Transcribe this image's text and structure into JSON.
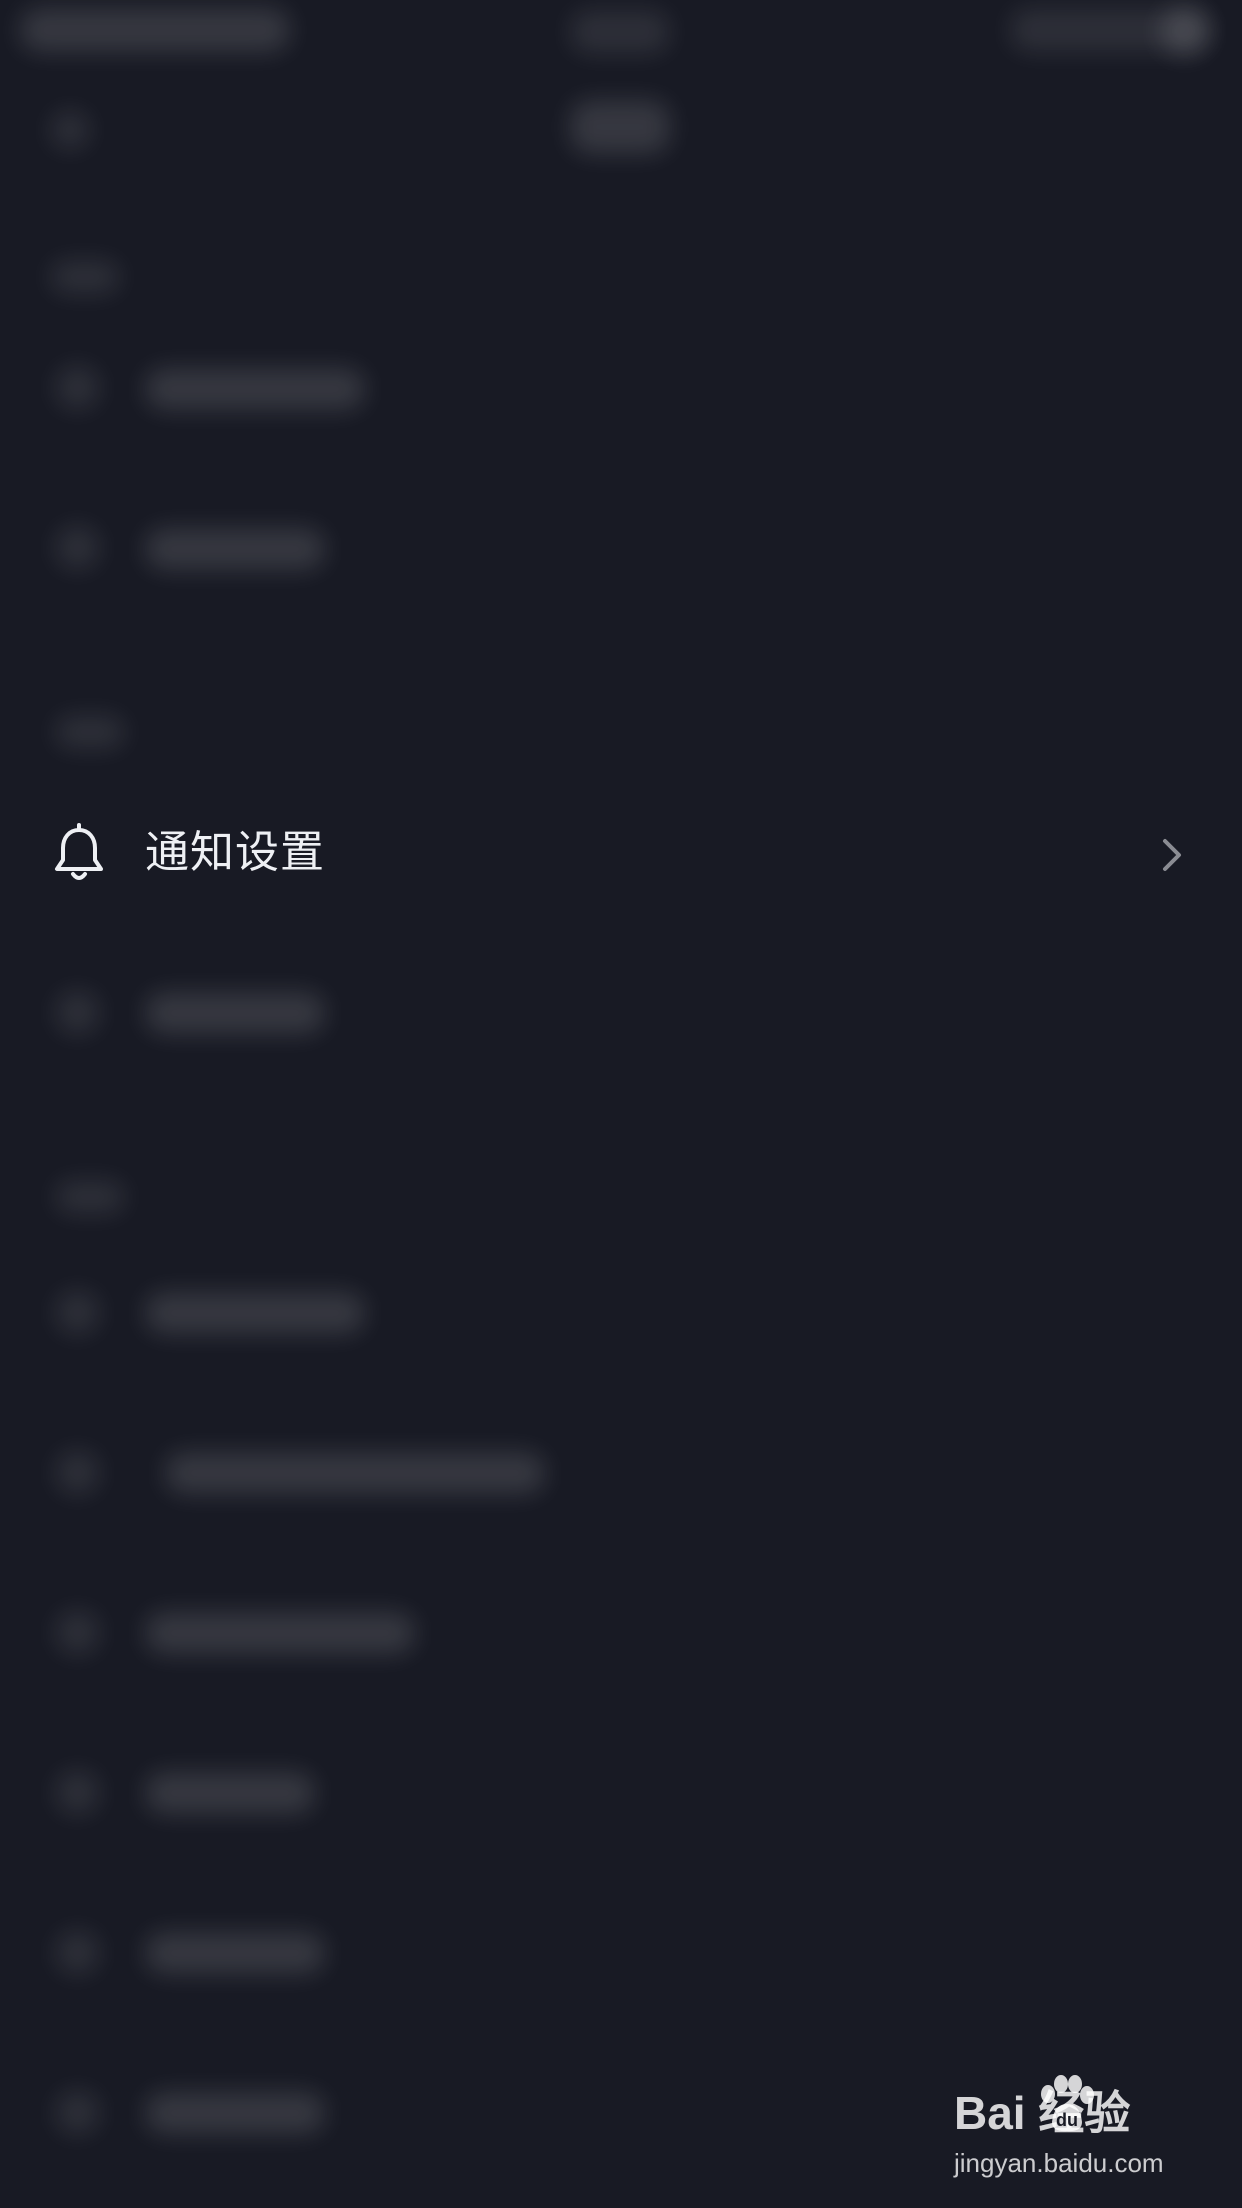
{
  "notification_row": {
    "label": "通知设置"
  },
  "icons": {
    "notification": "bell-icon",
    "row_arrow": "chevron-right-icon",
    "watermark_paw": "paw-icon"
  },
  "watermark": {
    "brand": "Bai  经验",
    "url": "jingyan.baidu.com"
  },
  "colors": {
    "background": "#181a24",
    "text": "#eef0f4",
    "chevron": "#8a8c93"
  }
}
